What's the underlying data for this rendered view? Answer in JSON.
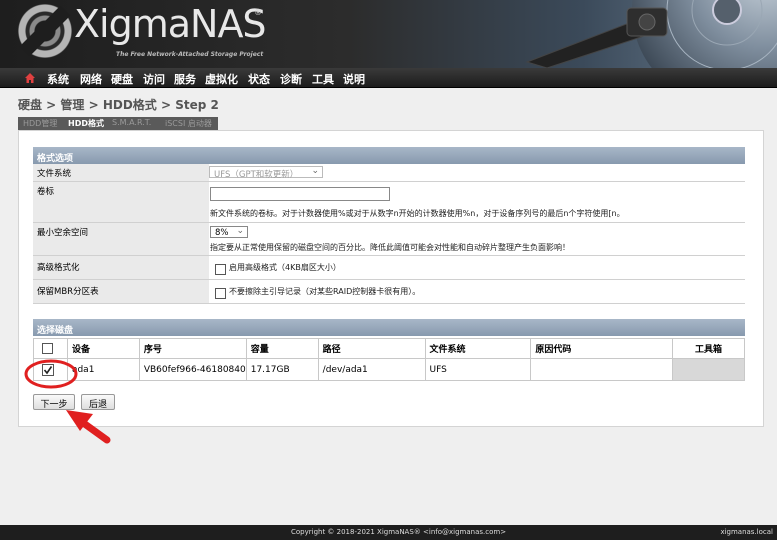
{
  "header": {
    "logo_text": "XigmaNAS",
    "logo_reg": "®",
    "tagline": "The Free Network-Attached Storage Project"
  },
  "nav": {
    "home_icon": "home-icon",
    "items": [
      "系统",
      "网络",
      "硬盘",
      "访问",
      "服务",
      "虚拟化",
      "状态",
      "诊断",
      "工具",
      "说明"
    ]
  },
  "breadcrumb": "硬盘 > 管理 > HDD格式 > Step 2",
  "subtabs": [
    {
      "label": "HDD管理",
      "active": false
    },
    {
      "label": "HDD格式",
      "active": true
    },
    {
      "label": "S.M.A.R.T.",
      "active": false
    },
    {
      "label": "iSCSI 启动器",
      "active": false
    }
  ],
  "format_options": {
    "section_title": "格式选项",
    "filesystem": {
      "label": "文件系统",
      "value": "UFS（GPT和软更新）"
    },
    "volume_label": {
      "label": "卷标",
      "value": "",
      "hint": "新文件系统的卷标。对于计数器使用%或对于从数字n开始的计数器使用%n，对于设备序列号的最后n个字符使用[n。"
    },
    "min_free": {
      "label": "最小空余空间",
      "value": "8%",
      "hint": "指定要从正常使用保留的磁盘空间的百分比。降低此阈值可能会对性能和自动碎片整理产生负面影响！"
    },
    "advanced_format": {
      "label": "高级格式化",
      "checkbox_label": "启用高级格式（4KB扇区大小）",
      "checked": false
    },
    "keep_mbr": {
      "label": "保留MBR分区表",
      "checkbox_label": "不要擦除主引导记录（对某些RAID控制器卡很有用）。",
      "checked": false
    }
  },
  "disk_selection": {
    "section_title": "选择磁盘",
    "columns": [
      "",
      "设备",
      "序号",
      "容量",
      "路径",
      "文件系统",
      "原因代码",
      "工具箱"
    ],
    "rows": [
      {
        "checked": true,
        "device": "ada1",
        "serial": "VB60fef966-46180840",
        "capacity": "17.17GB",
        "path": "/dev/ada1",
        "filesystem": "UFS",
        "reason": "",
        "toolbox": ""
      }
    ]
  },
  "buttons": {
    "next": "下一步",
    "back": "后退"
  },
  "footer": {
    "copyright": "Copyright © 2018-2021 XigmaNAS® <info@xigmanas.com>",
    "hostname": "xigmanas.local"
  },
  "colors": {
    "section_header": "#8fa0b4",
    "nav_bg": "#2b2b2b",
    "annotation": "#e02020"
  }
}
